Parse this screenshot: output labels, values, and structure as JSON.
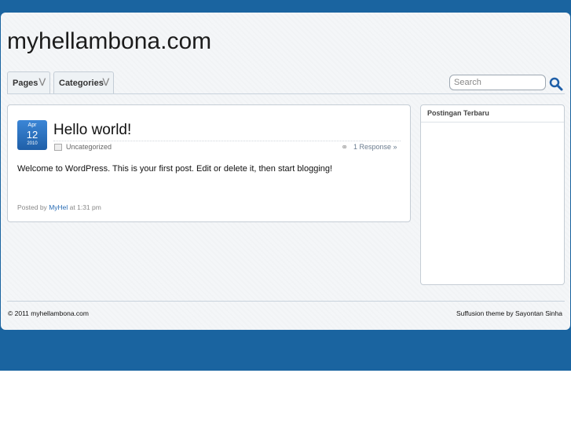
{
  "site": {
    "title": "myhellambona.com"
  },
  "nav": {
    "tabs": [
      {
        "label": "Pages"
      },
      {
        "label": "Categories"
      }
    ],
    "search_placeholder": "Search"
  },
  "post": {
    "date": {
      "month": "Apr",
      "day": "12",
      "year": "2010"
    },
    "title": "Hello world!",
    "category": "Uncategorized",
    "responses": "1 Response »",
    "body": "Welcome to WordPress. This is your first post. Edit or delete it, then start blogging!",
    "posted_by_prefix": "Posted by",
    "author": "MyHel",
    "time": "at 1:31 pm"
  },
  "sidebar": {
    "widget_title": "Postingan Terbaru"
  },
  "footer": {
    "copyright": "© 2011 myhellambona.com",
    "credit": "Suffusion theme by Sayontan Sinha"
  },
  "colors": {
    "accent": "#1a64a0",
    "link": "#2a6db5",
    "badge": "#2a72c2"
  },
  "icons": {
    "search": "search-icon",
    "category": "folder-icon",
    "responses": "comment-icon",
    "dropdown": "chevron-down-icon"
  }
}
